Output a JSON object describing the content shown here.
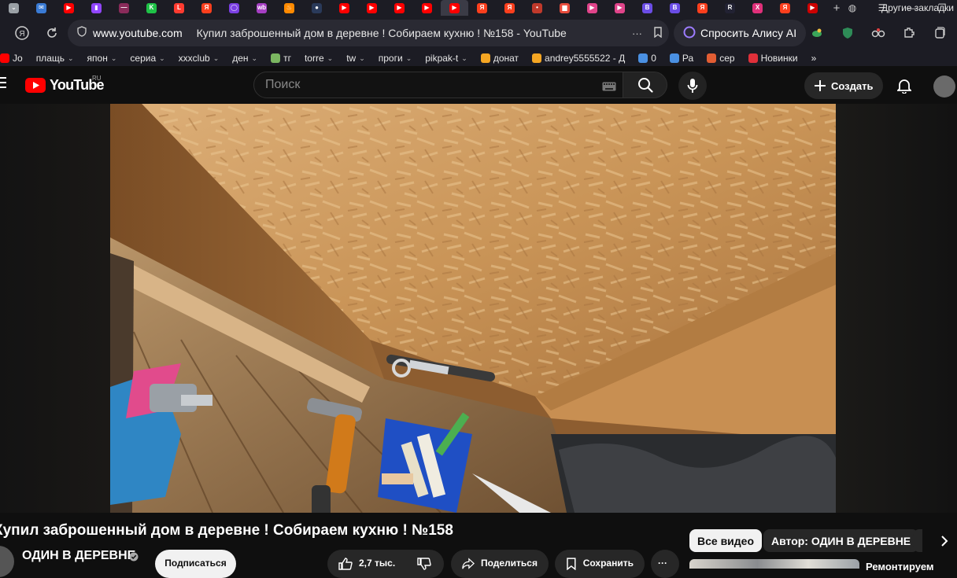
{
  "browser": {
    "tabs": [
      {
        "icon": "browser-menu-icon",
        "color": "#9aa0a6",
        "glyph": "⌄"
      },
      {
        "icon": "mail-icon",
        "color": "#3a7bd5",
        "glyph": "✉"
      },
      {
        "icon": "youtube-icon",
        "color": "#ff0000",
        "glyph": "▶"
      },
      {
        "icon": "twitch-icon",
        "color": "#9146ff",
        "glyph": "▮"
      },
      {
        "icon": "site-icon",
        "color": "#8a2b5a",
        "glyph": "—"
      },
      {
        "icon": "kick-icon",
        "color": "#1fc247",
        "glyph": "K"
      },
      {
        "icon": "live-icon",
        "color": "#ff3b30",
        "glyph": "L"
      },
      {
        "icon": "yandex-icon",
        "color": "#fc3f1d",
        "glyph": "Я"
      },
      {
        "icon": "circle-icon",
        "color": "#7b3fe4",
        "glyph": "◯"
      },
      {
        "icon": "wildberries-icon",
        "color": "#a63fc4",
        "glyph": "wb"
      },
      {
        "icon": "flame-icon",
        "color": "#ff8a00",
        "glyph": "♨"
      },
      {
        "icon": "dark-site-icon",
        "color": "#2a3a5a",
        "glyph": "●"
      },
      {
        "icon": "youtube-icon",
        "color": "#ff0000",
        "glyph": "▶"
      },
      {
        "icon": "youtube-icon",
        "color": "#ff0000",
        "glyph": "▶"
      },
      {
        "icon": "youtube-icon",
        "color": "#ff0000",
        "glyph": "▶"
      },
      {
        "icon": "youtube-icon",
        "color": "#ff0000",
        "glyph": "▶"
      },
      {
        "icon": "youtube-icon",
        "color": "#ff0000",
        "glyph": "▶",
        "active": true
      },
      {
        "icon": "yandex-icon",
        "color": "#fc3f1d",
        "glyph": "Я"
      },
      {
        "icon": "yandex-icon",
        "color": "#fc3f1d",
        "glyph": "Я"
      },
      {
        "icon": "dots-icon",
        "color": "#c0392b",
        "glyph": "•"
      },
      {
        "icon": "page-icon",
        "color": "#e74c3c",
        "glyph": "▆"
      },
      {
        "icon": "video-icon",
        "color": "#e0448a",
        "glyph": "▶"
      },
      {
        "icon": "video-icon",
        "color": "#e0448a",
        "glyph": "▶"
      },
      {
        "icon": "b-icon",
        "color": "#6b4de6",
        "glyph": "B"
      },
      {
        "icon": "b-icon",
        "color": "#6b4de6",
        "glyph": "B"
      },
      {
        "icon": "yandex-icon",
        "color": "#fc3f1d",
        "glyph": "Я"
      },
      {
        "icon": "r-icon",
        "color": "#222233",
        "glyph": "R"
      },
      {
        "icon": "x-icon",
        "color": "#e0307a",
        "glyph": "X"
      },
      {
        "icon": "yandex-icon",
        "color": "#fc3f1d",
        "glyph": "Я"
      },
      {
        "icon": "youtube-icon",
        "color": "#cc0000",
        "glyph": "▶"
      }
    ],
    "url": "www.youtube.com",
    "page_title": "Купил заброшенный дом в деревне ! Собираем кухню ! №158 - YouTube",
    "alice_label": "Спросить Алису AI",
    "bookmarks": [
      {
        "label": "Jo",
        "icon": "youtube-icon",
        "color": "#ff0000",
        "folder": false
      },
      {
        "label": "плащь",
        "folder": true
      },
      {
        "label": "япон",
        "folder": true
      },
      {
        "label": "сериа",
        "folder": true
      },
      {
        "label": "xxxclub",
        "folder": true
      },
      {
        "label": "ден",
        "folder": true
      },
      {
        "label": "тг",
        "icon": "plant-icon",
        "color": "#7bb661",
        "folder": false
      },
      {
        "label": "torre",
        "folder": true
      },
      {
        "label": "tw",
        "folder": true
      },
      {
        "label": "проги",
        "folder": true
      },
      {
        "label": "pikpak-t",
        "folder": true
      },
      {
        "label": "донат",
        "icon": "donate-icon",
        "color": "#f5a623",
        "folder": false
      },
      {
        "label": "andrey5555522 - Д",
        "icon": "donate-icon",
        "color": "#f5a623",
        "folder": false
      },
      {
        "label": "0",
        "icon": "clock-icon",
        "color": "#4a90e2",
        "folder": false
      },
      {
        "label": "Ра",
        "icon": "globe-icon",
        "color": "#4a90e2",
        "folder": false
      },
      {
        "label": "сер",
        "icon": "leaf-icon",
        "color": "#e25d33",
        "folder": false
      },
      {
        "label": "Новинки",
        "icon": "lf-icon",
        "color": "#e0303a",
        "folder": false
      }
    ],
    "bookmarks_more": "»",
    "other_bookmarks": "Другие закладки"
  },
  "youtube": {
    "wordmark": "YouTube",
    "region": "RU",
    "search_placeholder": "Поиск",
    "create_label": "Создать",
    "video_title": "Купил заброшенный дом в деревне ! Собираем кухню ! №158",
    "channel_name": "ОДИН В ДЕРЕВНЕ",
    "subscribe_label": "Подписаться",
    "like_count": "2,7 тыс.",
    "share_label": "Поделиться",
    "save_label": "Сохранить",
    "chips": [
      "Все видео",
      "Автор: ОДИН В ДЕРЕВНЕ"
    ],
    "recommended_title_fragment": "Ремонтируем"
  },
  "colors": {
    "brand_red": "#ff0000",
    "page_bg": "#0f0f0f",
    "browser_chrome": "#1c1c24"
  }
}
